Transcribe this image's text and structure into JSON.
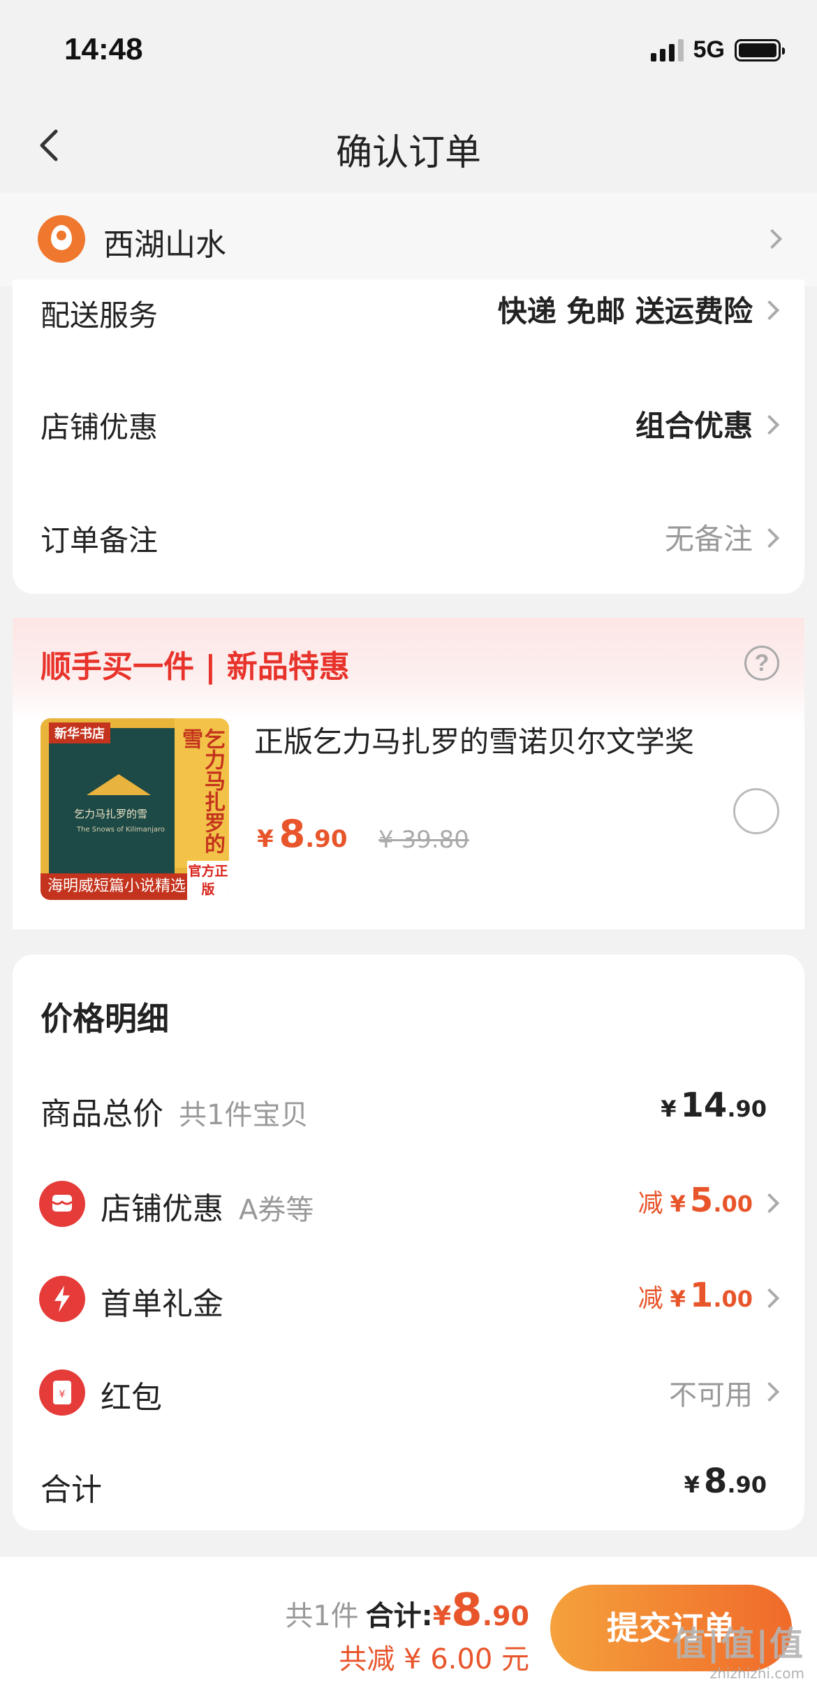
{
  "status_bar": {
    "time": "14:48",
    "network": "5G"
  },
  "nav": {
    "title": "确认订单"
  },
  "address": {
    "text": "西湖山水"
  },
  "service_rows": [
    {
      "label": "配送服务",
      "value": "快递 免邮 送运费险"
    },
    {
      "label": "店铺优惠",
      "value": "组合优惠"
    },
    {
      "label": "订单备注",
      "value": "无备注"
    }
  ],
  "deal": {
    "title": "顺手买一件 | 新品特惠",
    "product_name": "正版乞力马扎罗的雪诺贝尔文学奖",
    "price_currency": "¥",
    "price_int": "8",
    "price_dec": ".90",
    "original_price": "¥ 39.80",
    "cover": {
      "brand": "新华书店",
      "title_cn": "乞力马扎罗的雪",
      "title_en": "The Snows of Kilimanjaro",
      "side_text": "乞力马扎罗的雪",
      "tag": "海明威短篇小说精选",
      "official": "官方正版"
    }
  },
  "price_detail": {
    "title": "价格明细",
    "items_total": {
      "label": "商品总价",
      "sub": "共1件宝贝",
      "currency": "¥",
      "int": "14",
      "dec": ".90"
    },
    "shop_discount": {
      "label": "店铺优惠",
      "sub": "A券等",
      "prefix": "减",
      "currency": "¥",
      "int": "5",
      "dec": ".00"
    },
    "first_order": {
      "label": "首单礼金",
      "prefix": "减",
      "currency": "¥",
      "int": "1",
      "dec": ".00"
    },
    "red_packet": {
      "label": "红包",
      "value": "不可用"
    },
    "sum": {
      "label": "合计",
      "currency": "¥",
      "int": "8",
      "dec": ".90"
    }
  },
  "bottom": {
    "count": "共1件",
    "total_label": "合计:",
    "currency": "¥",
    "int": "8",
    "dec": ".90",
    "saved": "共减 ¥ 6.00 元",
    "submit_label": "提交订单"
  },
  "watermark": {
    "main": "值|值|值",
    "sub": "zhizhizhi.com"
  },
  "colors": {
    "accent": "#e8552b",
    "deal_red": "#e8332b",
    "button_start": "#f4a13c",
    "button_end": "#f06a2a"
  }
}
